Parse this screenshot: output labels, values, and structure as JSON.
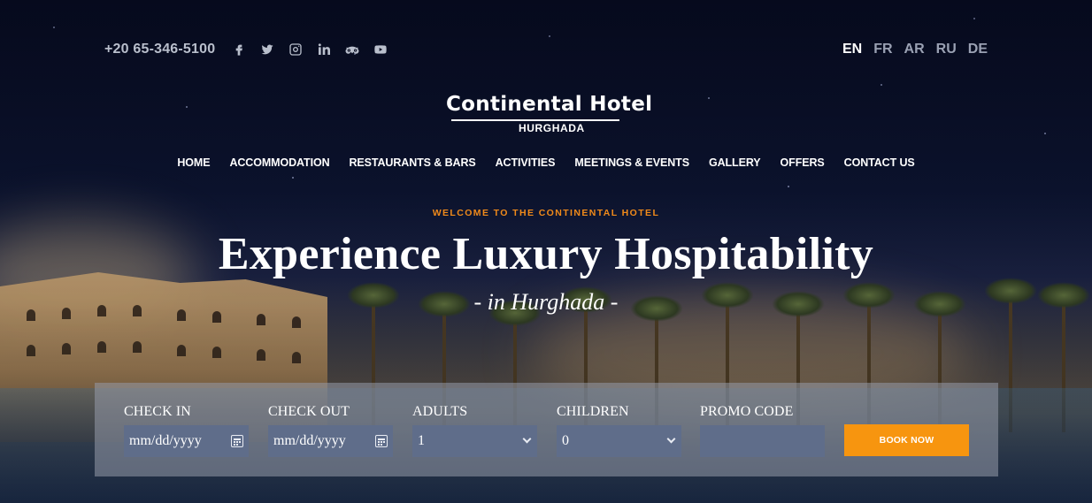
{
  "topbar": {
    "phone": "+20 65-346-5100",
    "social_icons": [
      "facebook-icon",
      "twitter-icon",
      "instagram-icon",
      "linkedin-icon",
      "tripadvisor-icon",
      "youtube-icon"
    ],
    "languages": [
      {
        "label": "EN",
        "active": true
      },
      {
        "label": "FR",
        "active": false
      },
      {
        "label": "AR",
        "active": false
      },
      {
        "label": "RU",
        "active": false
      },
      {
        "label": "DE",
        "active": false
      }
    ]
  },
  "logo": {
    "name": "Continental Hotel",
    "location": "HURGHADA"
  },
  "nav": {
    "items": [
      "HOME",
      "ACCOMMODATION",
      "RESTAURANTS & BARS",
      "ACTIVITIES",
      "MEETINGS & EVENTS",
      "GALLERY",
      "OFFERS",
      "CONTACT US"
    ]
  },
  "hero": {
    "eyebrow": "WELCOME TO THE CONTINENTAL HOTEL",
    "headline": "Experience Luxury Hospitability",
    "subline": "- in Hurghada -"
  },
  "booking": {
    "check_in_label": "CHECK IN",
    "check_in_value": "mm/dd/yyyy",
    "check_out_label": "CHECK OUT",
    "check_out_value": "mm/dd/yyyy",
    "adults_label": "ADULTS",
    "adults_value": "1",
    "children_label": "CHILDREN",
    "children_value": "0",
    "promo_label": "PROMO CODE",
    "promo_value": "",
    "book_button": "BOOK NOW"
  },
  "colors": {
    "accent": "#f7950f",
    "eyebrow": "#f08a1a",
    "field_bg": "#5f6d8a"
  }
}
